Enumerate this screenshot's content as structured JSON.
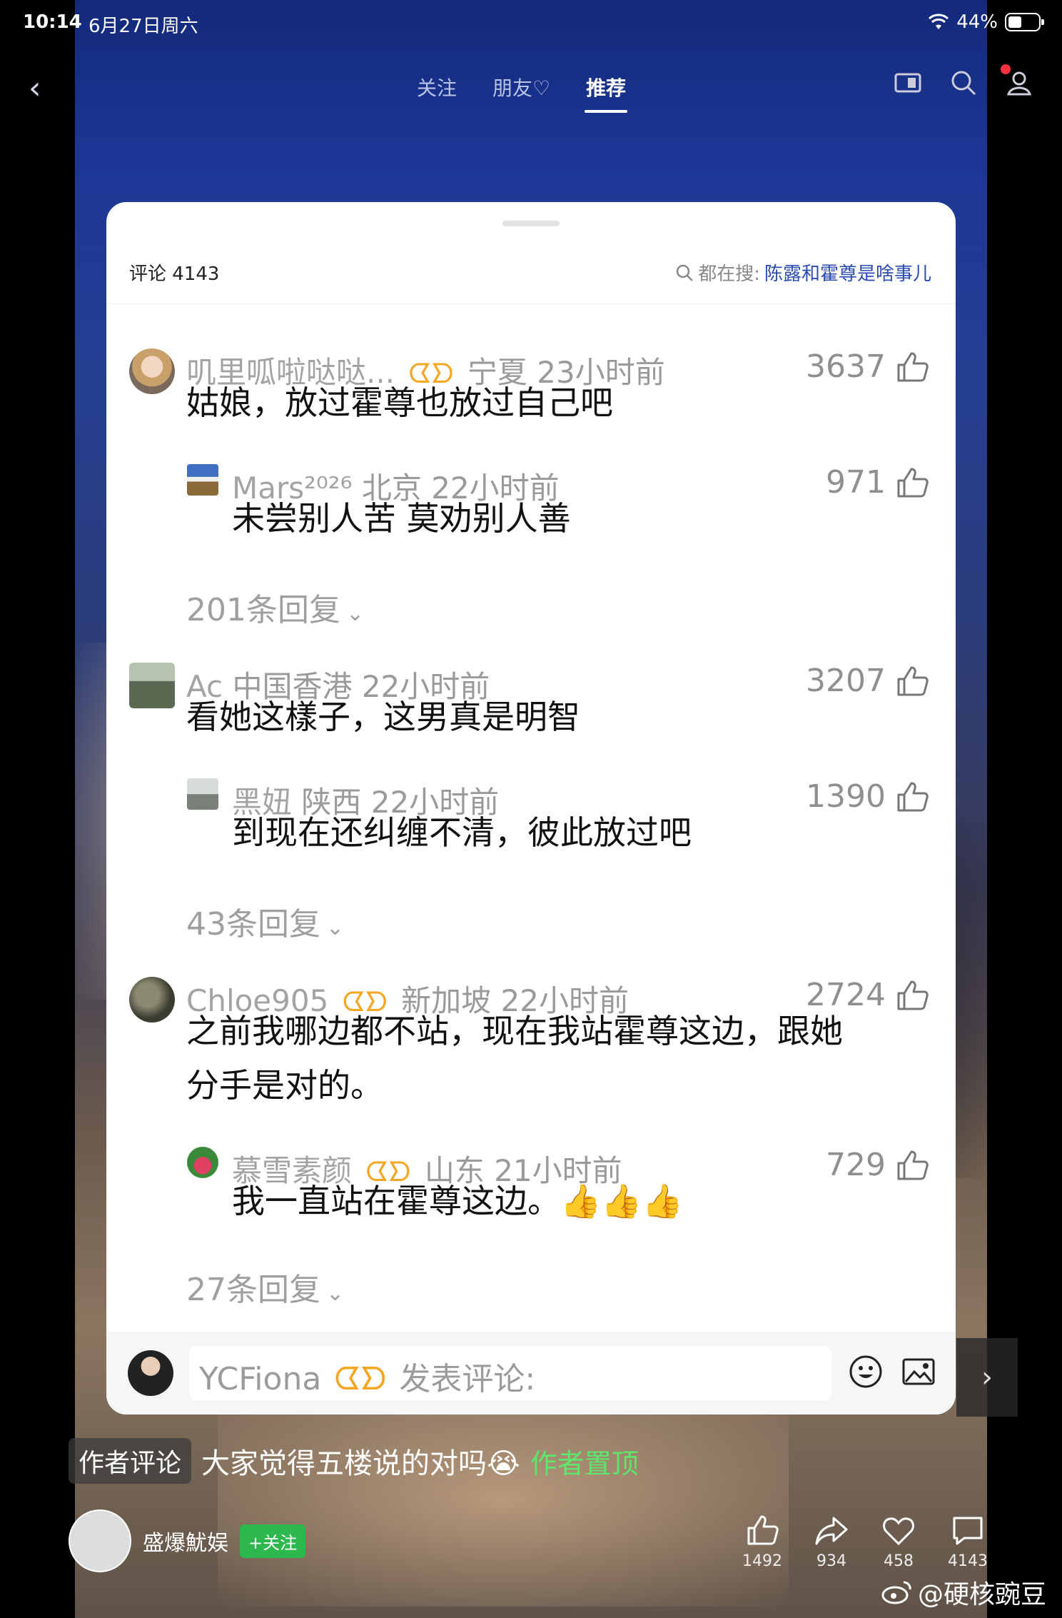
{
  "status": {
    "time": "10:14",
    "date": "6月27日周六",
    "battery": "44%"
  },
  "nav": {
    "tabs": [
      "关注",
      "朋友♡",
      "推荐"
    ],
    "active": "推荐"
  },
  "comments_panel": {
    "count_label": "评论 4143",
    "search_prefix": "都在搜:",
    "search_keyword": "陈露和霍尊是啥事儿",
    "comments": [
      {
        "name": "叽里呱啦哒哒...",
        "badge": "ᗧ",
        "location": "宁夏",
        "time": "23小时前",
        "likes": "3637",
        "text": "姑娘，放过霍尊也放过自己吧",
        "reply": {
          "name": "Mars²⁰²⁶",
          "location": "北京",
          "time": "22小时前",
          "likes": "971",
          "text": "未尝别人苦 莫劝别人善"
        },
        "more_replies": "201条回复"
      },
      {
        "name": "Ac",
        "location": "中国香港",
        "time": "22小时前",
        "likes": "3207",
        "text": "看她这樣子，这男真是明智",
        "reply": {
          "name": "黑妞",
          "location": "陕西",
          "time": "22小时前",
          "likes": "1390",
          "text": "到现在还纠缠不清，彼此放过吧"
        },
        "more_replies": "43条回复"
      },
      {
        "name": "Chloe905",
        "location": "新加坡",
        "time": "22小时前",
        "likes": "2724",
        "text_line1": "之前我哪边都不站，现在我站霍尊这边，跟她",
        "text_line2": "分手是对的。",
        "reply": {
          "name": "慕雪素颜",
          "location": "山东",
          "time": "21小时前",
          "likes": "729",
          "text": "我一直站在霍尊这边。👍👍👍"
        },
        "more_replies": "27条回复"
      }
    ],
    "input": {
      "user": "YCFiona",
      "placeholder": "发表评论:"
    }
  },
  "overlay": {
    "author_tag": "作者评论",
    "author_text": "大家觉得五楼说的对吗😭",
    "pinned": "作者置顶",
    "author_name": "盛爆魷娱",
    "follow": "+关注",
    "stats": {
      "like": "1492",
      "share": "934",
      "fav": "458",
      "comment": "4143"
    },
    "watermark": "@硬核豌豆"
  }
}
